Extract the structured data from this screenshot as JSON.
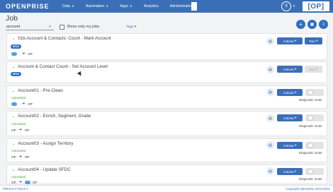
{
  "header": {
    "logo": "OPENPRISE",
    "nav": [
      {
        "label": "Data",
        "dropdown": true
      },
      {
        "label": "Automation",
        "dropdown": true
      },
      {
        "label": "Apps",
        "dropdown": true
      },
      {
        "label": "Analytics",
        "dropdown": false
      },
      {
        "label": "Administration",
        "dropdown": true
      }
    ],
    "user_initial": "S",
    "brand_mark": "[OP]"
  },
  "page": {
    "title": "Job",
    "search_value": "account",
    "show_only_label": "Show only my jobs",
    "tags_label": "Tags"
  },
  "jobs": [
    {
      "title": "01b.Account & Contacts: Count - Mark Account",
      "badge": "SFDC",
      "status": "",
      "source": "sfdc",
      "target": "OP",
      "actions": "Actions",
      "run": "Run",
      "diag": ""
    },
    {
      "title": "Account & Contact Count - Set Account Level",
      "badge": "SFDC",
      "status": "",
      "source": "",
      "target": "",
      "actions": "Actions",
      "run": "Run",
      "diag": ""
    },
    {
      "title": "Account01 - Pre-Clean",
      "badge": "",
      "status": "Automated",
      "source": "sfdc",
      "target": "OP",
      "actions": "Actions",
      "run": "",
      "diag": "Diagnostic mode"
    },
    {
      "title": "Account02 - Enrich, Segment, Grade",
      "badge": "",
      "status": "Automated",
      "source": "OP",
      "target": "OP",
      "actions": "Actions",
      "run": "",
      "diag": "Diagnostic mode"
    },
    {
      "title": "Account03 - Assign Territory",
      "badge": "",
      "status": "Automated",
      "source": "OP",
      "target": "OP",
      "actions": "Actions",
      "run": "",
      "diag": "Diagnostic mode"
    },
    {
      "title": "Account04 - Update SFDC",
      "badge": "",
      "status": "Automated",
      "source": "OP",
      "target": "sfdc",
      "extra": "OP",
      "actions": "Actions",
      "run": "",
      "diag": "Diagnostic mode"
    }
  ],
  "footer": {
    "privacy": "PRIVACY POLICY",
    "copyright": "Copyright Openprise 2014-2021"
  },
  "colors": {
    "nav_blue": "#3a6fb8",
    "button_blue": "#2f6fc4",
    "automated_green": "#4c9a44",
    "salesforce_blue": "#4aa3df"
  }
}
